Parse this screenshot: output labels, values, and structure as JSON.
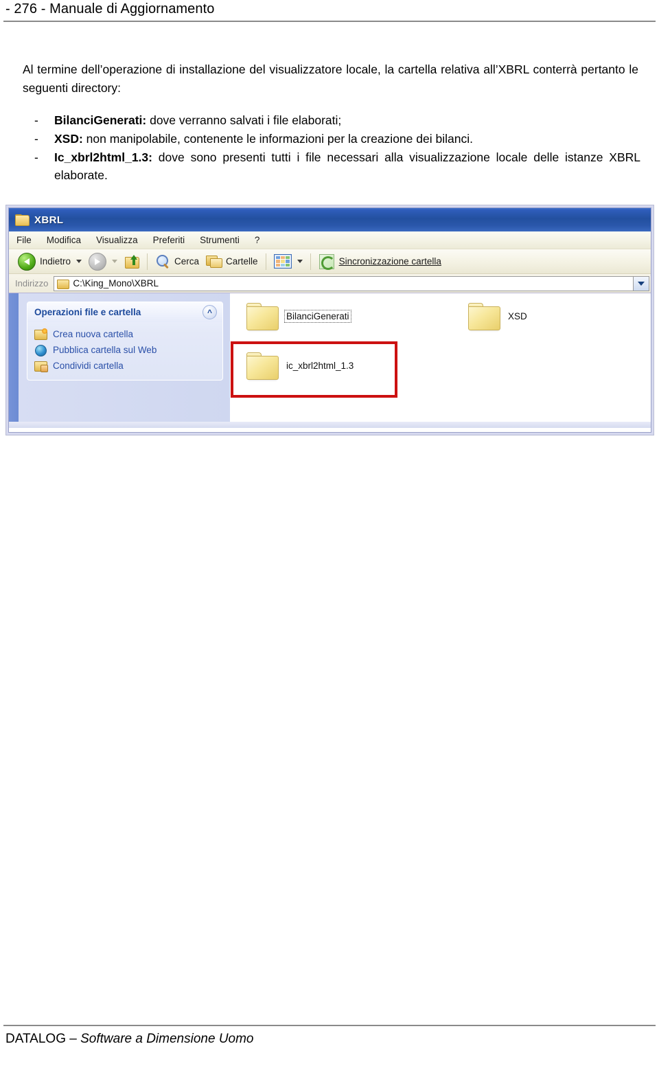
{
  "page": {
    "header": "- 276 -  Manuale di Aggiornamento",
    "footer_brand": "DATALOG – ",
    "footer_tagline": "Software a Dimensione Uomo"
  },
  "content": {
    "intro_paragraph": "Al termine dell’operazione di installazione del visualizzatore locale, la cartella relativa all’XBRL conterrà pertanto le seguenti directory:",
    "dash": "-",
    "bullets": [
      {
        "term": "BilanciGenerati:",
        "text": " dove verranno salvati i file elaborati;"
      },
      {
        "term": "XSD:",
        "text": " non manipolabile, contenente le informazioni per la creazione dei bilanci."
      },
      {
        "term": "Ic_xbrl2html_1.3:",
        "text": " dove sono presenti tutti i file necessari alla visualizzazione locale delle istanze XBRL elaborate."
      }
    ]
  },
  "explorer": {
    "title": "XBRL",
    "menu": [
      "File",
      "Modifica",
      "Visualizza",
      "Preferiti",
      "Strumenti",
      "?"
    ],
    "toolbar": {
      "back": "Indietro",
      "search": "Cerca",
      "folders": "Cartelle",
      "sync": "Sincronizzazione cartella"
    },
    "address": {
      "label": "Indirizzo",
      "path": "C:\\King_Mono\\XBRL"
    },
    "taskpane": {
      "group_title": "Operazioni file e cartella",
      "items": [
        "Crea nuova cartella",
        "Pubblica cartella sul Web",
        "Condividi cartella"
      ]
    },
    "folders": [
      {
        "name": "BilanciGenerati",
        "focused": true
      },
      {
        "name": "XSD",
        "focused": false
      },
      {
        "name": "ic_xbrl2html_1.3",
        "focused": false
      }
    ],
    "annotation_color": "#cc1111"
  }
}
